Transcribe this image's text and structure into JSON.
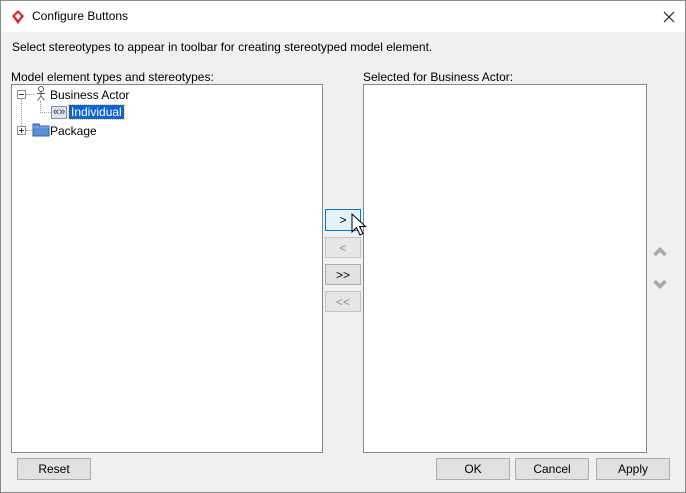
{
  "window": {
    "title": "Configure Buttons"
  },
  "instruction": "Select stereotypes to appear in toolbar for creating stereotyped model element.",
  "left_panel": {
    "label": "Model element types and stereotypes:",
    "tree": [
      {
        "label": "Business Actor",
        "expanded": true,
        "icon": "business-actor-icon",
        "children": [
          {
            "label": "Individual",
            "icon": "stereotype-icon",
            "stereotype_glyph": "«»",
            "selected": true
          }
        ]
      },
      {
        "label": "Package",
        "expanded": false,
        "icon": "package-folder-icon"
      }
    ]
  },
  "right_panel": {
    "label": "Selected for Business Actor:",
    "items": []
  },
  "transfer_buttons": {
    "add": ">",
    "remove": "<",
    "add_all": ">>",
    "remove_all": "<<"
  },
  "footer": {
    "reset": "Reset",
    "ok": "OK",
    "cancel": "Cancel",
    "apply": "Apply"
  },
  "colors": {
    "accent": "#0078d7",
    "selection": "#0a64d4",
    "app_icon": "#d9262c"
  }
}
